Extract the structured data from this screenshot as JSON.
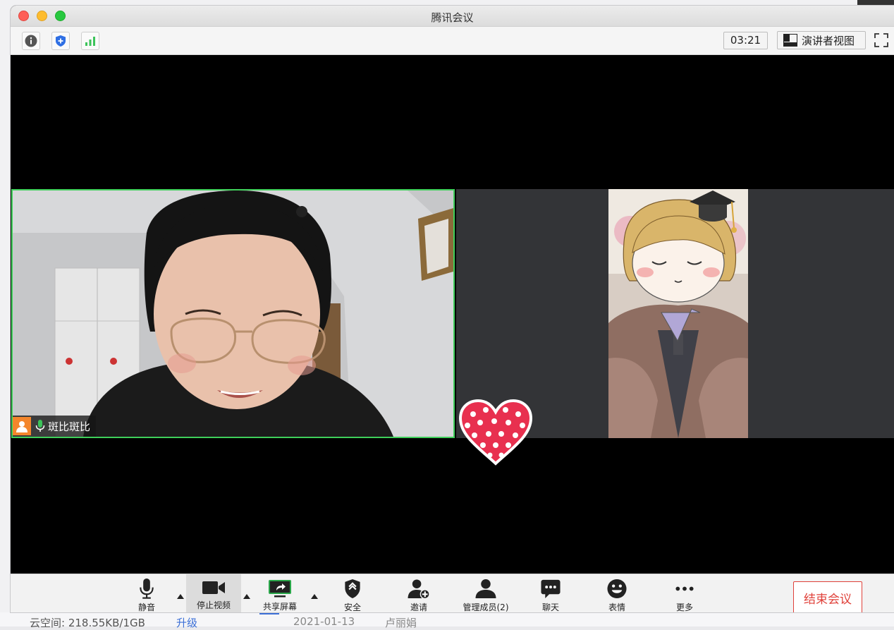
{
  "window": {
    "title": "腾讯会议"
  },
  "toolbar": {
    "info_icon": "info-icon",
    "security_icon": "shield-plus-icon",
    "signal_icon": "signal-bars-icon",
    "timer": "03:21",
    "speaker_view_label": "演讲者视图",
    "fullscreen_icon": "fullscreen-icon"
  },
  "participants": [
    {
      "name": "斑比斑比",
      "active_speaker": true,
      "mic": "on"
    },
    {
      "name": "",
      "active_speaker": false
    }
  ],
  "reaction": {
    "emoji": "heart"
  },
  "controls": [
    {
      "id": "mute",
      "label": "静音",
      "icon": "microphone-icon",
      "has_menu": true
    },
    {
      "id": "video",
      "label": "停止视频",
      "icon": "video-camera-icon",
      "has_menu": true,
      "active": true
    },
    {
      "id": "share",
      "label": "共享屏幕",
      "icon": "share-screen-icon",
      "has_menu": true
    },
    {
      "id": "security",
      "label": "安全",
      "icon": "security-shield-icon"
    },
    {
      "id": "invite",
      "label": "邀请",
      "icon": "invite-user-icon"
    },
    {
      "id": "members",
      "label": "管理成员(2)",
      "icon": "members-icon"
    },
    {
      "id": "chat",
      "label": "聊天",
      "icon": "chat-bubble-icon"
    },
    {
      "id": "reactions",
      "label": "表情",
      "icon": "smiley-icon"
    },
    {
      "id": "more",
      "label": "更多",
      "icon": "more-dots-icon"
    }
  ],
  "end_meeting_label": "结束会议",
  "background_app": {
    "storage_text": "云空间: 218.55KB/1GB",
    "upgrade": "升级",
    "date": "2021-01-13",
    "user": "卢丽娟"
  },
  "colors": {
    "active_speaker_border": "#3fcf5a",
    "end_button": "#e0413a",
    "heart": "#e8304f"
  }
}
